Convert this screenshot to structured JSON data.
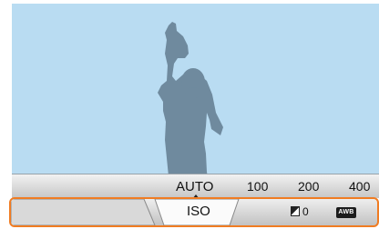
{
  "iso_scale": {
    "values": [
      "AUTO",
      "100",
      "200",
      "400"
    ],
    "selected": "AUTO"
  },
  "menu": {
    "active_tab": "ISO",
    "ev_value": "0",
    "awb_label": "AWB"
  },
  "colors": {
    "sky": "#b9dcf2",
    "silhouette": "#6f8a9e",
    "highlight_border": "#f07c22"
  },
  "icons": {
    "ev": "exposure-compensation-icon",
    "awb": "auto-white-balance-icon"
  }
}
